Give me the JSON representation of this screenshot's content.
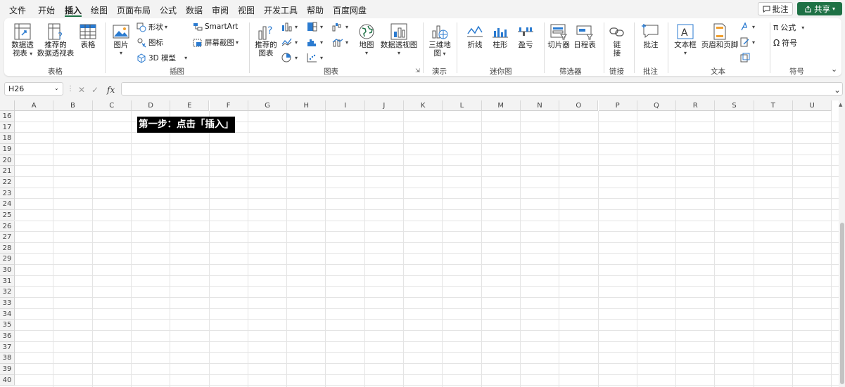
{
  "menu": {
    "tabs": [
      "文件",
      "开始",
      "插入",
      "绘图",
      "页面布局",
      "公式",
      "数据",
      "审阅",
      "视图",
      "开发工具",
      "帮助",
      "百度网盘"
    ],
    "active_tab": "插入",
    "comments_button": "批注",
    "share_button": "共享"
  },
  "ribbon": {
    "groups": {
      "tables": "表格",
      "illustrations": "插图",
      "charts": "图表",
      "tours": "演示",
      "sparklines": "迷你图",
      "filters": "筛选器",
      "links": "链接",
      "comments": "批注",
      "text": "文本",
      "symbols": "符号"
    },
    "items": {
      "pivot_table_line1": "数据透",
      "pivot_table_line2": "视表",
      "recommended_pivot_line1": "推荐的",
      "recommended_pivot_line2": "数据透视表",
      "table": "表格",
      "pictures": "图片",
      "shapes": "形状",
      "icons": "图标",
      "models_3d": "3D 模型",
      "smartart": "SmartArt",
      "screenshot": "屏幕截图",
      "recommended_charts_line1": "推荐的",
      "recommended_charts_line2": "图表",
      "maps": "地图",
      "pivot_chart": "数据透视图",
      "map_3d_line1": "三维地",
      "map_3d_line2": "图",
      "spark_line": "折线",
      "spark_column": "柱形",
      "spark_winloss": "盈亏",
      "slicer": "切片器",
      "timeline": "日程表",
      "link_line1": "链",
      "link_line2": "接",
      "comment": "批注",
      "text_box": "文本框",
      "header_footer": "页眉和页脚",
      "equation": "公式",
      "symbol": "符号"
    }
  },
  "formula_bar": {
    "name_box": "H26",
    "fx_label": "fx",
    "value": ""
  },
  "sheet": {
    "columns": [
      "A",
      "B",
      "C",
      "D",
      "E",
      "F",
      "G",
      "H",
      "I",
      "J",
      "K",
      "L",
      "M",
      "N",
      "O",
      "P",
      "Q",
      "R",
      "S",
      "T",
      "U"
    ],
    "rows": [
      "16",
      "17",
      "18",
      "19",
      "20",
      "21",
      "22",
      "23",
      "24",
      "25",
      "26",
      "27",
      "28",
      "29",
      "30",
      "31",
      "32",
      "33",
      "34",
      "35",
      "36",
      "37",
      "38",
      "39",
      "40"
    ],
    "callout_text": "第一步：点击「插入」"
  },
  "colors": {
    "accent": "#1e7145",
    "callout_bg": "#000000",
    "callout_text": "#ffffff"
  }
}
